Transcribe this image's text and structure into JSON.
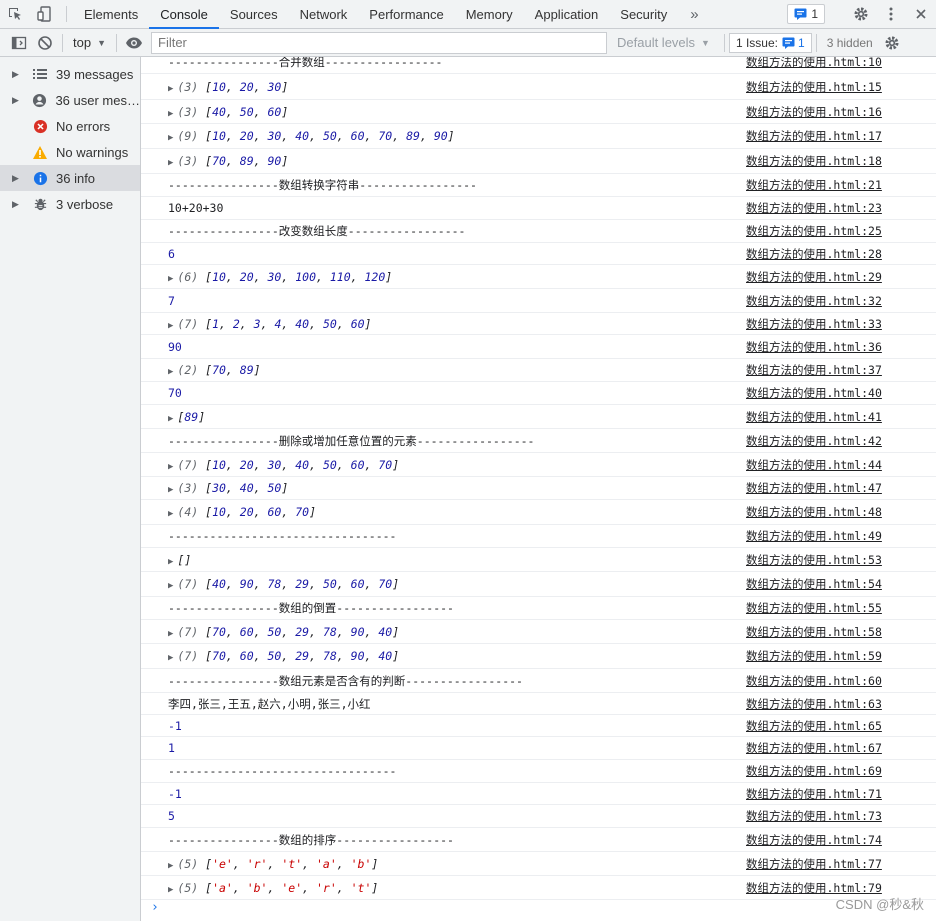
{
  "tabs": [
    "Elements",
    "Console",
    "Sources",
    "Network",
    "Performance",
    "Memory",
    "Application",
    "Security"
  ],
  "active_tab": "Console",
  "tab_overflow": "»",
  "message_badge_count": "1",
  "toolbar": {
    "context": "top",
    "filter_placeholder": "Filter",
    "default_levels": "Default levels",
    "issues_label": "1 Issue:",
    "issues_count": "1",
    "hidden": "3 hidden"
  },
  "sidebar": [
    {
      "label": "39 messages",
      "icon": "list-icon",
      "expandable": true,
      "selected": false
    },
    {
      "label": "36 user mes…",
      "icon": "user-icon",
      "expandable": true,
      "selected": false
    },
    {
      "label": "No errors",
      "icon": "error-icon",
      "expandable": false,
      "selected": false
    },
    {
      "label": "No warnings",
      "icon": "warning-icon",
      "expandable": false,
      "selected": false
    },
    {
      "label": "36 info",
      "icon": "info-icon",
      "expandable": true,
      "selected": true
    },
    {
      "label": "3 verbose",
      "icon": "bug-icon",
      "expandable": true,
      "selected": false
    }
  ],
  "messages": [
    {
      "kind": "text",
      "text": "----------------合并数组-----------------",
      "src": "数组方法的使用.html:10"
    },
    {
      "kind": "array",
      "count": "(3)",
      "items": [
        "10",
        "20",
        "30"
      ],
      "src": "数组方法的使用.html:15"
    },
    {
      "kind": "array",
      "count": "(3)",
      "items": [
        "40",
        "50",
        "60"
      ],
      "src": "数组方法的使用.html:16"
    },
    {
      "kind": "array",
      "count": "(9)",
      "items": [
        "10",
        "20",
        "30",
        "40",
        "50",
        "60",
        "70",
        "89",
        "90"
      ],
      "src": "数组方法的使用.html:17"
    },
    {
      "kind": "array",
      "count": "(3)",
      "items": [
        "70",
        "89",
        "90"
      ],
      "src": "数组方法的使用.html:18"
    },
    {
      "kind": "text",
      "text": "----------------数组转换字符串-----------------",
      "src": "数组方法的使用.html:21"
    },
    {
      "kind": "text",
      "text": "10+20+30",
      "src": "数组方法的使用.html:23"
    },
    {
      "kind": "text",
      "text": "----------------改变数组长度-----------------",
      "src": "数组方法的使用.html:25"
    },
    {
      "kind": "number",
      "text": "6",
      "src": "数组方法的使用.html:28"
    },
    {
      "kind": "array",
      "count": "(6)",
      "items": [
        "10",
        "20",
        "30",
        "100",
        "110",
        "120"
      ],
      "src": "数组方法的使用.html:29"
    },
    {
      "kind": "number",
      "text": "7",
      "src": "数组方法的使用.html:32"
    },
    {
      "kind": "array",
      "count": "(7)",
      "items": [
        "1",
        "2",
        "3",
        "4",
        "40",
        "50",
        "60"
      ],
      "src": "数组方法的使用.html:33"
    },
    {
      "kind": "number",
      "text": "90",
      "src": "数组方法的使用.html:36"
    },
    {
      "kind": "array",
      "count": "(2)",
      "items": [
        "70",
        "89"
      ],
      "src": "数组方法的使用.html:37"
    },
    {
      "kind": "number",
      "text": "70",
      "src": "数组方法的使用.html:40"
    },
    {
      "kind": "array",
      "count": "",
      "items": [
        "89"
      ],
      "src": "数组方法的使用.html:41"
    },
    {
      "kind": "text",
      "text": "----------------删除或增加任意位置的元素-----------------",
      "src": "数组方法的使用.html:42"
    },
    {
      "kind": "array",
      "count": "(7)",
      "items": [
        "10",
        "20",
        "30",
        "40",
        "50",
        "60",
        "70"
      ],
      "src": "数组方法的使用.html:44"
    },
    {
      "kind": "array",
      "count": "(3)",
      "items": [
        "30",
        "40",
        "50"
      ],
      "src": "数组方法的使用.html:47"
    },
    {
      "kind": "array",
      "count": "(4)",
      "items": [
        "10",
        "20",
        "60",
        "70"
      ],
      "src": "数组方法的使用.html:48"
    },
    {
      "kind": "text",
      "text": "---------------------------------",
      "src": "数组方法的使用.html:49"
    },
    {
      "kind": "array",
      "count": "",
      "items": [],
      "src": "数组方法的使用.html:53"
    },
    {
      "kind": "array",
      "count": "(7)",
      "items": [
        "40",
        "90",
        "78",
        "29",
        "50",
        "60",
        "70"
      ],
      "src": "数组方法的使用.html:54"
    },
    {
      "kind": "text",
      "text": "----------------数组的倒置-----------------",
      "src": "数组方法的使用.html:55"
    },
    {
      "kind": "array",
      "count": "(7)",
      "items": [
        "70",
        "60",
        "50",
        "29",
        "78",
        "90",
        "40"
      ],
      "src": "数组方法的使用.html:58"
    },
    {
      "kind": "array",
      "count": "(7)",
      "items": [
        "70",
        "60",
        "50",
        "29",
        "78",
        "90",
        "40"
      ],
      "src": "数组方法的使用.html:59"
    },
    {
      "kind": "text",
      "text": "----------------数组元素是否含有的判断-----------------",
      "src": "数组方法的使用.html:60"
    },
    {
      "kind": "text",
      "text": "李四,张三,王五,赵六,小明,张三,小红",
      "src": "数组方法的使用.html:63"
    },
    {
      "kind": "number",
      "text": "-1",
      "src": "数组方法的使用.html:65"
    },
    {
      "kind": "number",
      "text": "1",
      "src": "数组方法的使用.html:67"
    },
    {
      "kind": "text",
      "text": "---------------------------------",
      "src": "数组方法的使用.html:69"
    },
    {
      "kind": "number",
      "text": "-1",
      "src": "数组方法的使用.html:71"
    },
    {
      "kind": "number",
      "text": "5",
      "src": "数组方法的使用.html:73"
    },
    {
      "kind": "text",
      "text": "----------------数组的排序-----------------",
      "src": "数组方法的使用.html:74"
    },
    {
      "kind": "strarray",
      "count": "(5)",
      "items": [
        "'e'",
        "'r'",
        "'t'",
        "'a'",
        "'b'"
      ],
      "src": "数组方法的使用.html:77"
    },
    {
      "kind": "strarray",
      "count": "(5)",
      "items": [
        "'a'",
        "'b'",
        "'e'",
        "'r'",
        "'t'"
      ],
      "src": "数组方法的使用.html:79"
    }
  ],
  "prompt": "›",
  "watermark": "CSDN @秒&秋"
}
